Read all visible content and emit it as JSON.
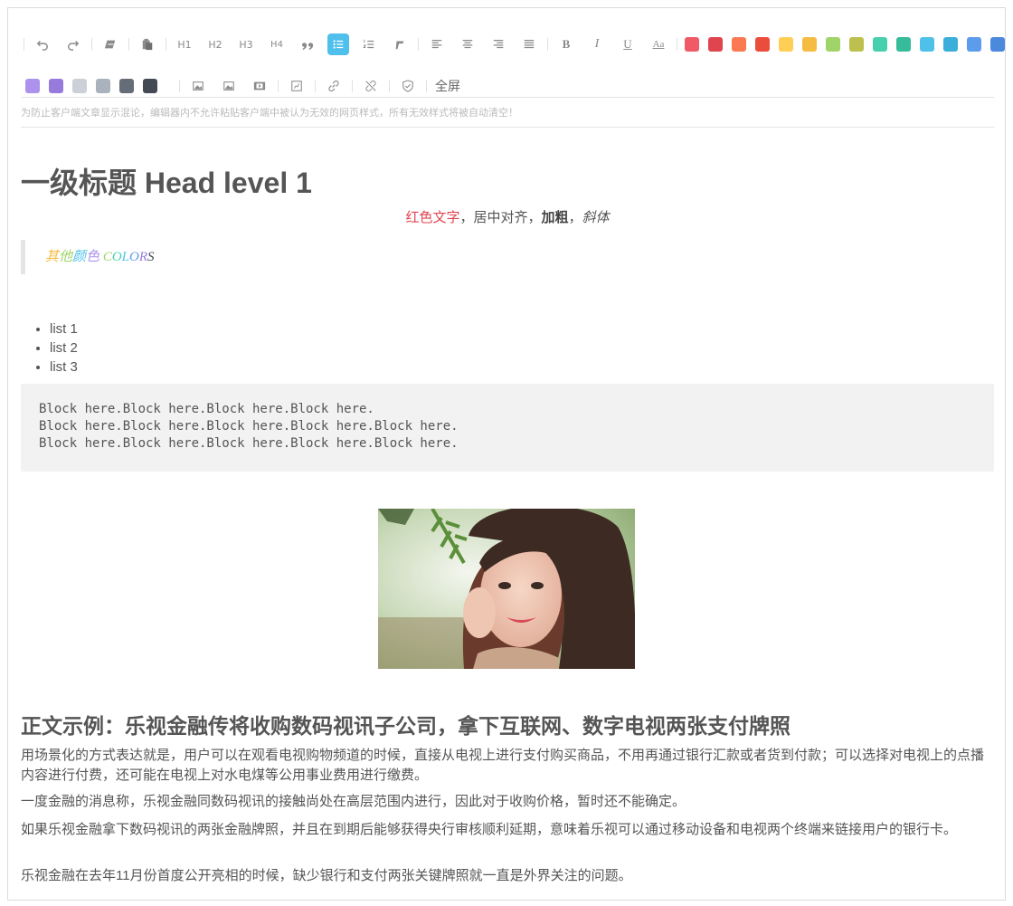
{
  "toolbar": {
    "buttons": {
      "h1": "H1",
      "h2": "H2",
      "h3": "H3",
      "h4": "H4",
      "font_size": "Aa",
      "bold": "B",
      "italic": "I",
      "underline": "U",
      "fullscreen": "全屏"
    },
    "colors": [
      "#f05a67",
      "#e0454f",
      "#fb7a52",
      "#eb4d3d",
      "#ffce54",
      "#f6bb42",
      "#a0d468",
      "#bdc04e",
      "#48cfad",
      "#37bc9b",
      "#4fc1e9",
      "#3bafda",
      "#5d9cec",
      "#4a89dc",
      "#ac92ec",
      "#967adc",
      "#ccd1d9",
      "#aab2bd",
      "#656d78",
      "#434a54"
    ]
  },
  "notice": "为防止客户端文章显示混论，编辑器内不允许粘贴客户端中被认为无效的网页样式，所有无效样式将被自动清空！",
  "content": {
    "heading1": "一级标题 Head level 1",
    "center_line": {
      "red_text": "红色文字",
      "sep1": "，居中对齐，",
      "bold_text": "加粗",
      "sep2": "，",
      "italic_text": "斜体"
    },
    "quote_chars": [
      {
        "t": "其",
        "c": "#f6bb42"
      },
      {
        "t": "他",
        "c": "#a0d468"
      },
      {
        "t": "颜",
        "c": "#4fc1e9"
      },
      {
        "t": "色",
        "c": "#ac92ec"
      },
      {
        "t": " ",
        "c": "#555555"
      },
      {
        "t": "C",
        "c": "#a0d468"
      },
      {
        "t": "O",
        "c": "#48cfad"
      },
      {
        "t": "L",
        "c": "#4fc1e9"
      },
      {
        "t": "O",
        "c": "#5d9cec"
      },
      {
        "t": "R",
        "c": "#967adc"
      },
      {
        "t": "S",
        "c": "#434a54"
      }
    ],
    "list_items": [
      "list 1",
      "list 2",
      "list 3"
    ],
    "code_block": "Block here.Block here.Block here.Block here.\nBlock here.Block here.Block here.Block here.Block here.\nBlock here.Block here.Block here.Block here.Block here.",
    "heading2": "正文示例：乐视金融传将收购数码视讯子公司，拿下互联网、数字电视两张支付牌照",
    "paragraphs": [
      "用场景化的方式表达就是，用户可以在观看电视购物频道的时候，直接从电视上进行支付购买商品，不用再通过银行汇款或者货到付款；可以选择对电视上的点播内容进行付费，还可能在电视上对水电煤等公用事业费用进行缴费。",
      "一度金融的消息称，乐视金融同数码视讯的接触尚处在高层范围内进行，因此对于收购价格，暂时还不能确定。",
      "如果乐视金融拿下数码视讯的两张金融牌照，并且在到期后能够获得央行审核顺利延期，意味着乐视可以通过移动设备和电视两个终端来链接用户的银行卡。",
      "乐视金融在去年11月份首度公开亮相的时候，缺少银行和支付两张关键牌照就一直是外界关注的问题。"
    ]
  }
}
